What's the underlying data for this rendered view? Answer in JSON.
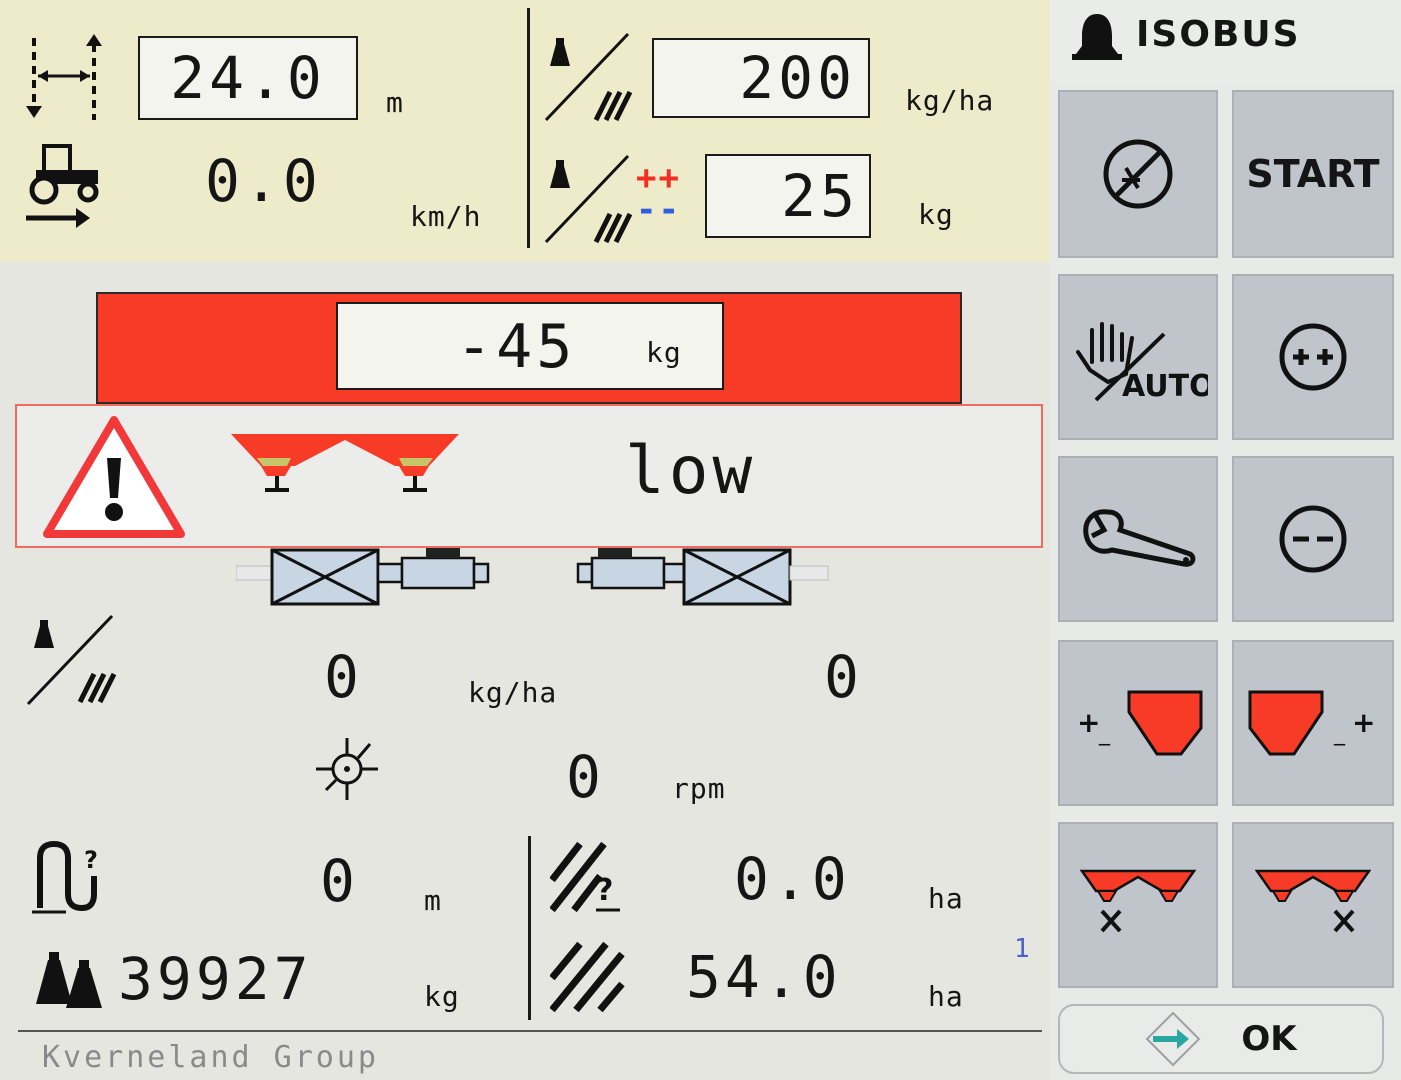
{
  "top": {
    "working_width": {
      "value": "24.0",
      "unit": "m"
    },
    "speed": {
      "value": "0.0",
      "unit": "km/h"
    },
    "target_rate": {
      "value": "200",
      "unit": "kg/ha"
    },
    "rate_step": {
      "value": "25",
      "unit": "kg",
      "plus": "++",
      "minus": "--"
    }
  },
  "weighing": {
    "value": "-45",
    "unit": "kg"
  },
  "alarm": {
    "text": "low"
  },
  "middle": {
    "actual_rate_left": "0",
    "actual_rate_unit": "kg/ha",
    "actual_rate_right": "0",
    "disc_speed": {
      "value": "0",
      "unit": "rpm"
    }
  },
  "bottom": {
    "distance": {
      "value": "0",
      "unit": "m"
    },
    "total_weight": {
      "value": "39927",
      "unit": "kg"
    },
    "area_partial": {
      "value": "0.0",
      "unit": "ha"
    },
    "area_total": {
      "value": "54.0",
      "unit": "ha"
    },
    "counter_index": "1"
  },
  "footer": {
    "brand": "Kverneland Group"
  },
  "sidebar": {
    "header": "ISOBUS",
    "start_label": "START",
    "auto_label": "AUTO",
    "ok_label": "OK"
  },
  "colors": {
    "accent_red": "#f73b26",
    "top_panel": "#eeebcb",
    "button_grey": "#bfc5cb",
    "ok_arrow": "#2aa7a0"
  },
  "icons": [
    "working-width-icon",
    "tractor-speed-icon",
    "rate-per-area-icon",
    "rate-step-icon",
    "warning-icon",
    "hopper-icon",
    "disc-speed-icon",
    "headland-distance-icon",
    "total-weight-icon",
    "area-partial-icon",
    "area-total-icon",
    "bell-icon",
    "speed-sensor-off-icon",
    "manual-auto-icon",
    "rate-plus-icon",
    "wrench-icon",
    "rate-minus-icon",
    "left-hopper-adjust-icon",
    "right-hopper-adjust-icon",
    "left-section-off-icon",
    "right-section-off-icon",
    "ok-arrow-icon"
  ]
}
